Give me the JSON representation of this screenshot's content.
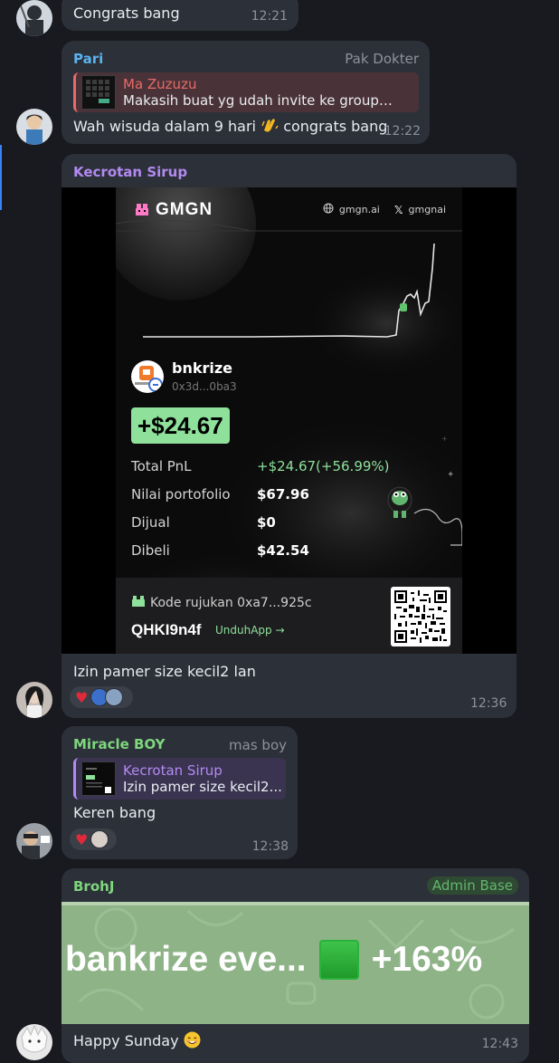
{
  "messages": {
    "m1": {
      "text": "Congrats bang",
      "time": "12:21"
    },
    "m2": {
      "sender": "Pari",
      "sender_color": "#5ab3f0",
      "forward_label": "Pak Dokter",
      "reply_name": "Ma Zuzuzu",
      "reply_color": "#e8696a",
      "reply_text": "Makasih buat yg udah invite ke group ...",
      "text": "Wah wisuda dalam 9 hari",
      "text_after": "congrats bang",
      "time": "12:22"
    },
    "m3": {
      "sender": "Kecrotan Sirup",
      "sender_color": "#b38af2",
      "caption": "Izin pamer size kecil2 lan",
      "time": "12:36",
      "card": {
        "brand": "GMGN",
        "site": "gmgn.ai",
        "x_handle": "gmgnai",
        "user_name": "bnkrize",
        "user_addr": "0x3d...0ba3",
        "pnl_big": "+$24.67",
        "stats": [
          {
            "label": "Total PnL",
            "value": "+$24.67(+56.99%)",
            "accent": "#7fe08a"
          },
          {
            "label": "Nilai portofolio",
            "value": "$67.96",
            "accent": "#ffffff"
          },
          {
            "label": "Dijual",
            "value": "$0",
            "accent": "#ffffff"
          },
          {
            "label": "Dibeli",
            "value": "$42.54",
            "accent": "#ffffff"
          }
        ],
        "referral_label": "Kode rujukan 0xa7...925c",
        "referral_code": "QHKI9n4f",
        "app_link": "UnduhApp →",
        "pnl_color": "#7fe08a"
      }
    },
    "m4": {
      "sender": "Miracle BOY",
      "sender_color": "#7fd67f",
      "forward_label": "mas boy",
      "reply_name": "Kecrotan Sirup",
      "reply_color": "#b38af2",
      "reply_text": "Izin pamer size kecil2...",
      "text": "Keren bang",
      "time": "12:38"
    },
    "m5": {
      "sender": "BrohJ",
      "sender_color": "#7fd67f",
      "admin_tag": "Admin Base",
      "banner_text": "bankrize eve...",
      "banner_pct": "+163%",
      "text": "Happy Sunday",
      "time": "12:43"
    }
  },
  "icons": [
    "heart-icon",
    "clap-emoji",
    "smile-emoji",
    "globe-icon",
    "x-logo-icon",
    "frog-icon",
    "qr-code",
    "green-square-emoji"
  ]
}
